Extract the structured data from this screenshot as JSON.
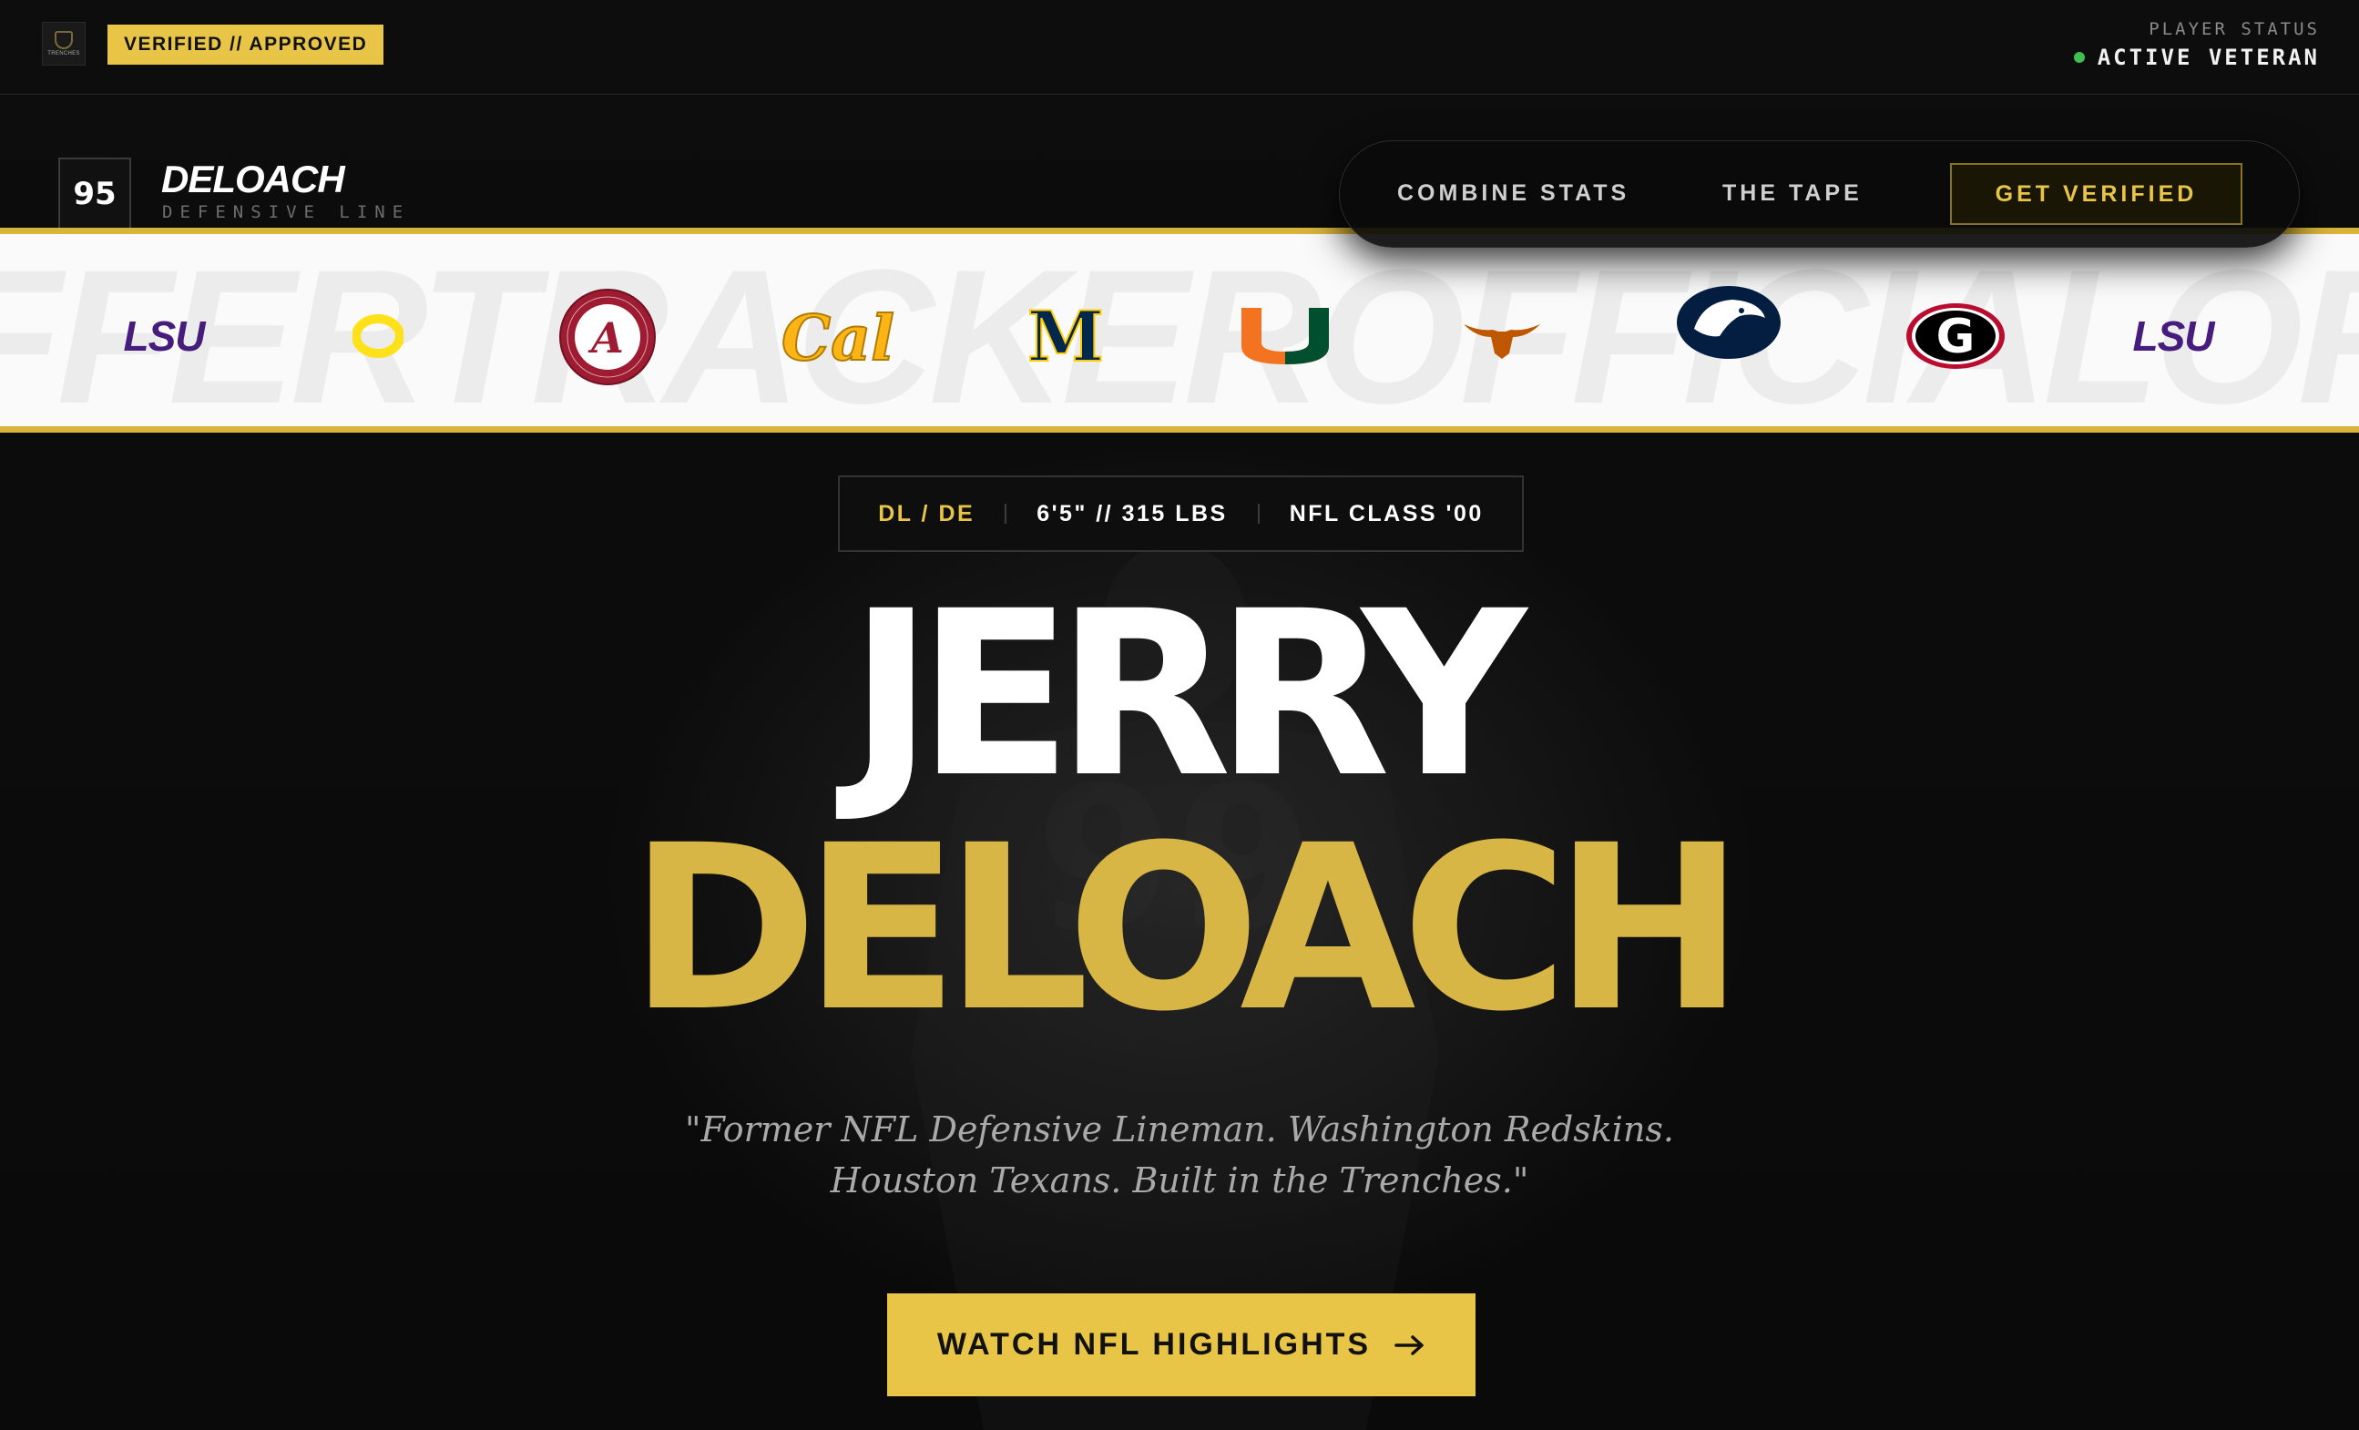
{
  "header": {
    "logo_text": "TRENCHES",
    "verified_badge": "VERIFIED // APPROVED",
    "status_label": "PLAYER STATUS",
    "status_value": "ACTIVE VETERAN"
  },
  "brand": {
    "jersey_number": "95",
    "name": "DELOACH",
    "position": "DEFENSIVE LINE"
  },
  "nav": {
    "links": [
      "COMBINE STATS",
      "THE TAPE"
    ],
    "cta_label": "GET VERIFIED"
  },
  "logo_strip": {
    "watermark": "FFERTRACKEROFFICIALOFFE",
    "teams": [
      {
        "name": "LSU",
        "text": "LSU",
        "color": "#461d7c"
      },
      {
        "name": "Oregon",
        "text": "O",
        "color": "#fee11a"
      },
      {
        "name": "Alabama",
        "text": "A",
        "ring_text": "ALABAMA CRIMSON TIDE",
        "color": "#9e1b32"
      },
      {
        "name": "Cal",
        "text": "Cal",
        "color": "#fdb515"
      },
      {
        "name": "Michigan",
        "text": "M",
        "color": "#00274c"
      },
      {
        "name": "Miami",
        "text": "U",
        "color": "#f47321"
      },
      {
        "name": "Texas",
        "text": "longhorn",
        "color": "#bf5700"
      },
      {
        "name": "Penn State",
        "text": "nittany-lion",
        "color": "#041e42"
      },
      {
        "name": "Georgia",
        "text": "G",
        "color": "#ba0c2f"
      },
      {
        "name": "LSU",
        "text": "LSU",
        "color": "#461d7c"
      }
    ]
  },
  "meta": {
    "position": "DL / DE",
    "size": "6'5\" // 315 LBS",
    "class": "NFL CLASS '00"
  },
  "hero": {
    "first_name": "JERRY",
    "last_name": "DELOACH",
    "quote_line1": "\"Former NFL Defensive Lineman. Washington Redskins.",
    "quote_line2": "Houston Texans. Built in the Trenches.\"",
    "cta_label": "WATCH NFL HIGHLIGHTS",
    "cta_icon": "arrow-right-icon"
  },
  "colors": {
    "accent": "#e8c547",
    "background": "#0b0b0b",
    "status_active": "#3fbf4f"
  }
}
